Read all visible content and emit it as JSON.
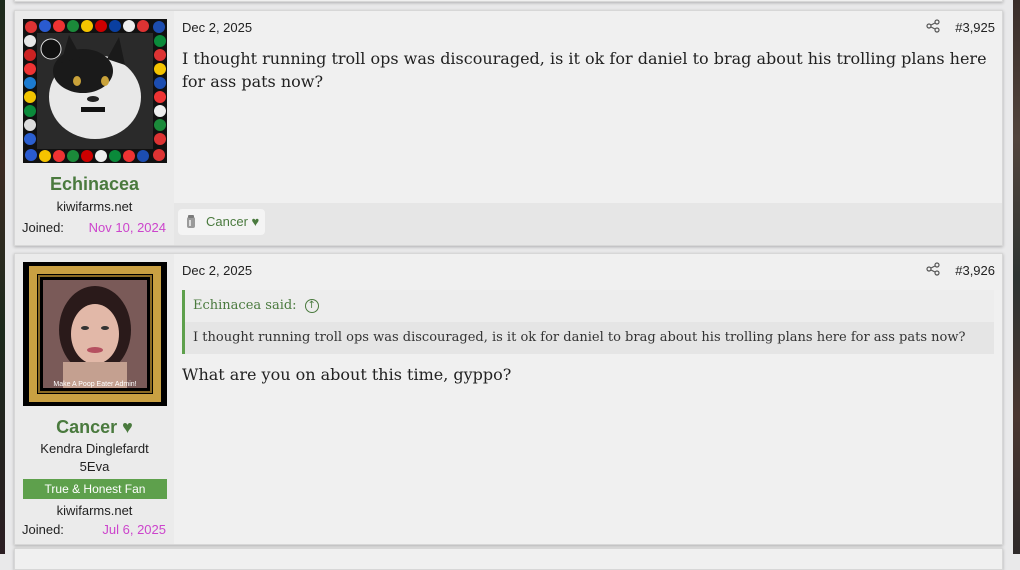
{
  "posts": [
    {
      "username": "Echinacea",
      "user_site": "kiwifarms.net",
      "joined_label": "Joined:",
      "joined_date": "Nov 10, 2024",
      "date": "Dec 2, 2025",
      "post_number": "#3,925",
      "message": "I thought running troll ops was discouraged, is it ok for daniel to brag about his trolling plans here for ass pats now?",
      "reaction_user": "Cancer ♥"
    },
    {
      "username": "Cancer ♥",
      "user_title": "Kendra Dinglefardt 5Eva",
      "banner": "True & Honest Fan",
      "user_site": "kiwifarms.net",
      "joined_label": "Joined:",
      "joined_date": "Jul 6, 2025",
      "date": "Dec 2, 2025",
      "post_number": "#3,926",
      "quote_author": "Echinacea said:",
      "quote_text": "I thought running troll ops was discouraged, is it ok for daniel to brag about his trolling plans here for ass pats now?",
      "message": "What are you on about this time, gyppo?",
      "avatar_caption": "Make A Poop Eater Admin!"
    }
  ],
  "colors": {
    "username": "#4a7a3e",
    "joined_date": "#cc44cc",
    "banner_bg": "#5ea04c"
  },
  "icons": [
    "share-icon",
    "reaction-icon",
    "quote-arrow-up-icon"
  ]
}
